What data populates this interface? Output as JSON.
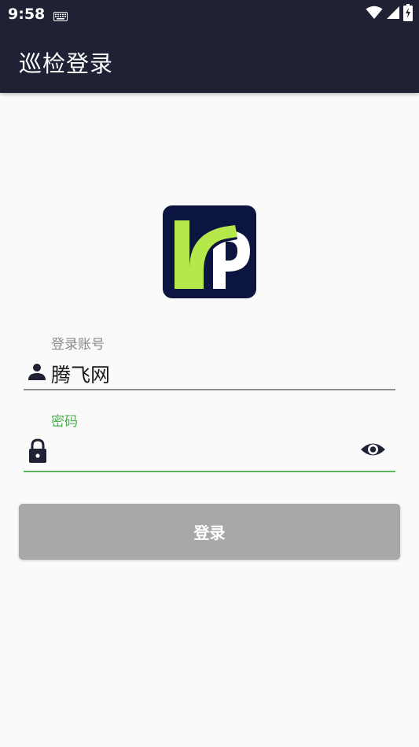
{
  "status_bar": {
    "time": "9:58",
    "icons": [
      "keyboard-icon",
      "wifi-icon",
      "signal-icon",
      "battery-charging-icon"
    ]
  },
  "app_bar": {
    "title": "巡检登录"
  },
  "logo": {
    "icon": "logo-icon",
    "colors": {
      "background": "#0c1540",
      "green": "#b5e84a",
      "white": "#ffffff"
    }
  },
  "login_form": {
    "account": {
      "label": "登录账号",
      "value": "腾飞网",
      "icon": "person-icon"
    },
    "password": {
      "label": "密码",
      "value": "",
      "icon": "lock-icon",
      "toggle_icon": "eye-icon"
    },
    "submit_label": "登录"
  },
  "colors": {
    "app_bar": "#1f2235",
    "focus_accent": "#4caf50",
    "button_disabled": "#a8a8a8",
    "page_background": "#fafafa"
  }
}
